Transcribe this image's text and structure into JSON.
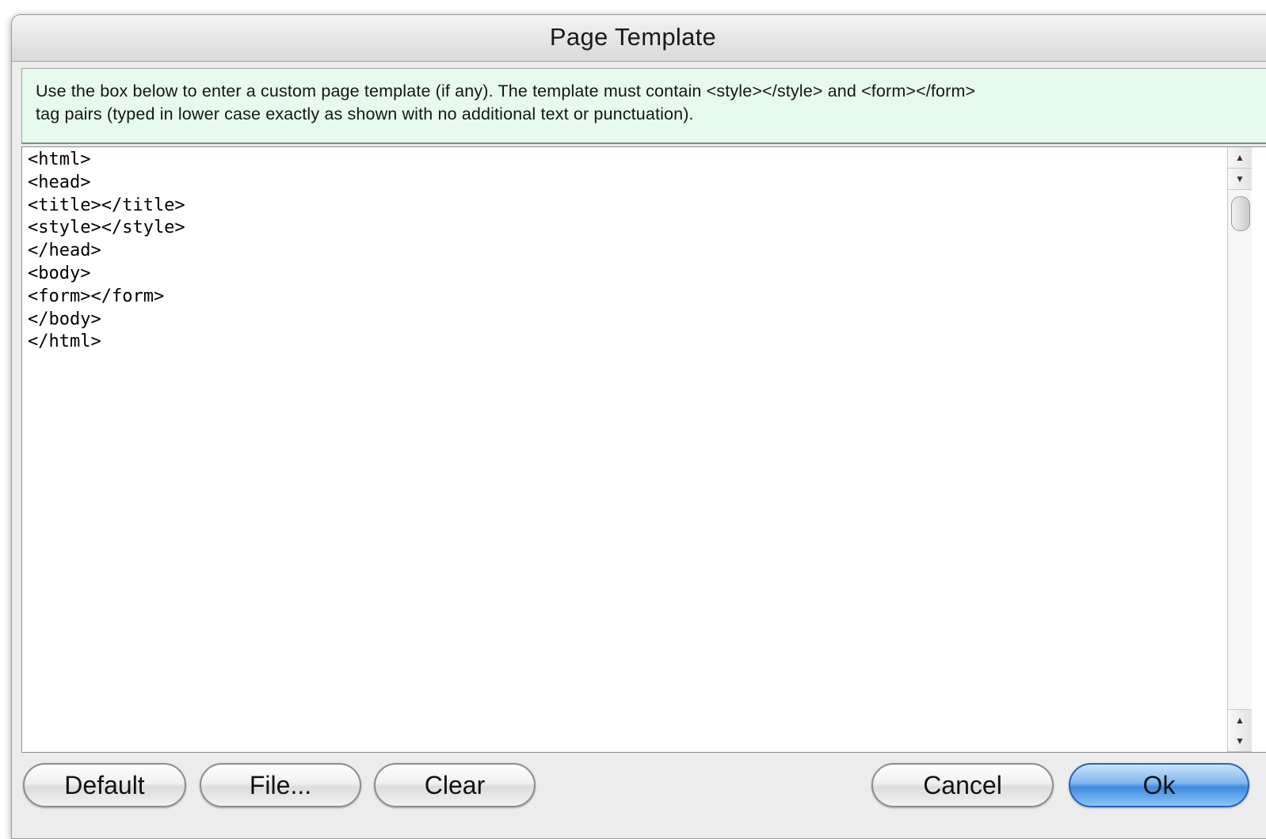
{
  "window": {
    "title": "Page Template"
  },
  "info": {
    "text": "Use the box below to enter a custom page template (if any). The template must contain <style></style> and <form></form>\ntag pairs (typed in lower case exactly as shown with no additional text or punctuation)."
  },
  "editor": {
    "value": "<html>\n<head>\n<title></title>\n<style></style>\n</head>\n<body>\n<form></form>\n</body>\n</html>"
  },
  "scrollbar": {
    "up_icon": "arrow-up-icon",
    "down_icon": "arrow-down-icon"
  },
  "buttons": {
    "default": "Default",
    "file": "File...",
    "clear": "Clear",
    "cancel": "Cancel",
    "ok": "Ok"
  },
  "colors": {
    "info_background": "#e6fbee",
    "primary_button": "#3e8ae0"
  }
}
